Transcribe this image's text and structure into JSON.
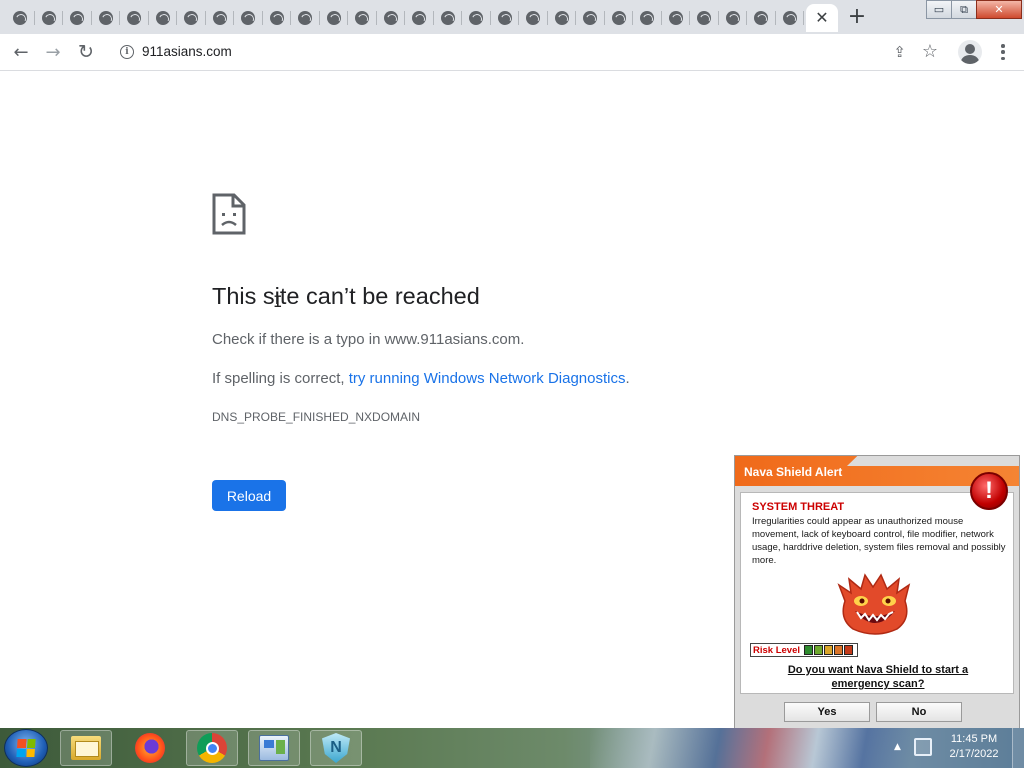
{
  "browser": {
    "tab_count": 28,
    "tab_icon": "globe-icon",
    "active_tab_close": "✕",
    "new_tab": "+",
    "window_buttons": {
      "minimize": "▭",
      "restore": "⧉",
      "close": "✕"
    }
  },
  "toolbar": {
    "url": "911asians.com",
    "back_icon": "←",
    "forward_icon": "→",
    "reload_icon": "↻",
    "info_icon": "i",
    "share_icon": "⇪",
    "star_icon": "☆"
  },
  "error_page": {
    "title": "This site can’t be reached",
    "typo_message": "Check if there is a typo in www.911asians.com.",
    "spelling_prefix": "If spelling is correct, ",
    "diagnostics_link": "try running Windows Network Diagnostics",
    "spelling_suffix": ".",
    "error_code": "DNS_PROBE_FINISHED_NXDOMAIN",
    "reload_button": "Reload"
  },
  "nava_popup": {
    "title": "Nava Shield Alert",
    "alert_icon": "!",
    "threat_heading": "SYSTEM THREAT",
    "description": "Irregularities could appear as unauthorized mouse movement, lack of keyboard control, file modifier, network usage, harddrive deletion, system files removal and possibly more.",
    "risk_label": "Risk Level",
    "risk_segments": [
      {
        "color": "#2e8b2e"
      },
      {
        "color": "#6ea82e"
      },
      {
        "color": "#d9a52a"
      },
      {
        "color": "#d9742a"
      },
      {
        "color": "#c23a1a"
      }
    ],
    "question": "Do you want Nava Shield to start a emergency scan?",
    "yes_button": "Yes",
    "no_button": "No"
  },
  "taskbar": {
    "apps": [
      {
        "name": "Windows Explorer"
      },
      {
        "name": "Firefox"
      },
      {
        "name": "Google Chrome"
      },
      {
        "name": "Control Panel"
      },
      {
        "name": "Nava Shield"
      }
    ],
    "tray_arrow": "▲",
    "time": "11:45 PM",
    "date": "2/17/2022"
  },
  "colors": {
    "link": "#1a73e8",
    "reload_button": "#1a73e8",
    "threat_red": "#cc0000",
    "popup_header": "#f06a1a"
  }
}
